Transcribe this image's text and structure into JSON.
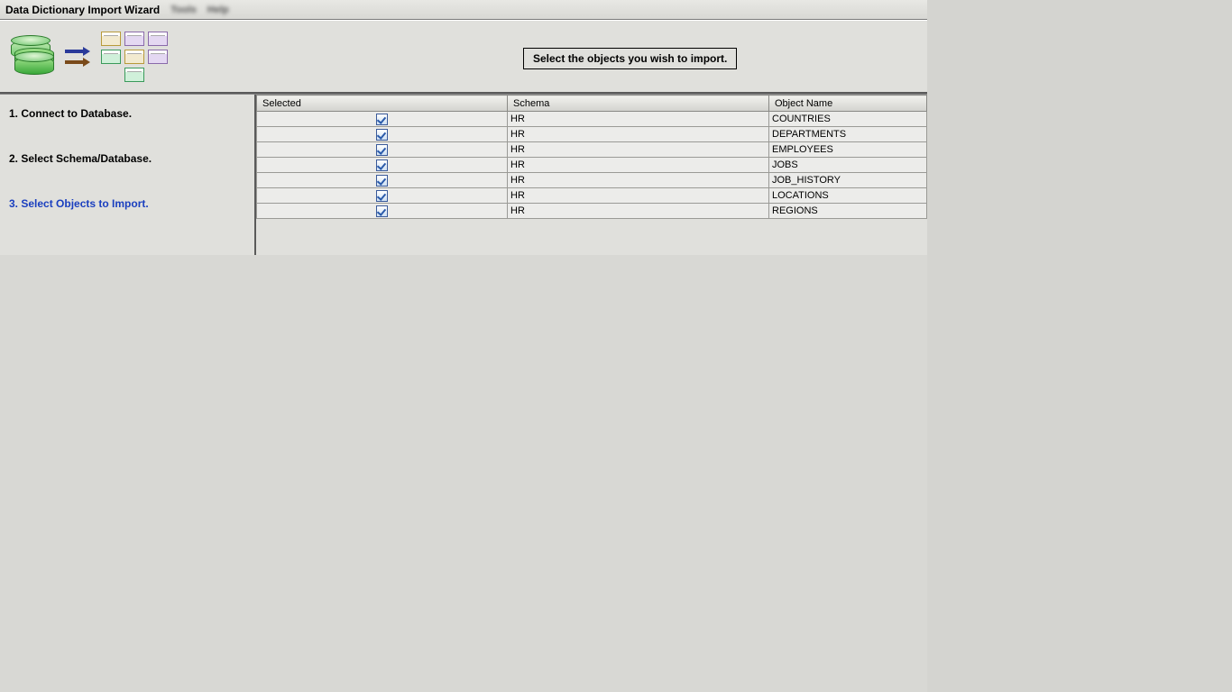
{
  "titlebar": {
    "title": "Data Dictionary Import Wizard",
    "blur1": "Tools",
    "blur2": "Help"
  },
  "instruction": "Select the objects you wish to import.",
  "steps": [
    {
      "label": "1. Connect to Database.",
      "active": false
    },
    {
      "label": "2. Select Schema/Database.",
      "active": false
    },
    {
      "label": "3. Select Objects to Import.",
      "active": true
    }
  ],
  "table": {
    "headers": {
      "selected": "Selected",
      "schema": "Schema",
      "object": "Object Name"
    },
    "rows": [
      {
        "selected": true,
        "schema": "HR",
        "object": "COUNTRIES"
      },
      {
        "selected": true,
        "schema": "HR",
        "object": "DEPARTMENTS"
      },
      {
        "selected": true,
        "schema": "HR",
        "object": "EMPLOYEES"
      },
      {
        "selected": true,
        "schema": "HR",
        "object": "JOBS"
      },
      {
        "selected": true,
        "schema": "HR",
        "object": "JOB_HISTORY"
      },
      {
        "selected": true,
        "schema": "HR",
        "object": "LOCATIONS"
      },
      {
        "selected": true,
        "schema": "HR",
        "object": "REGIONS"
      }
    ]
  }
}
